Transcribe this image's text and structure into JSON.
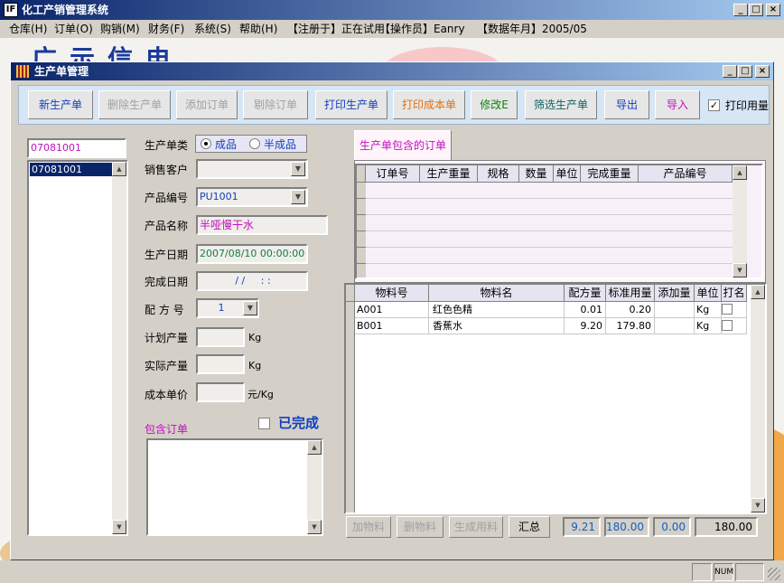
{
  "app": {
    "title": "化工产销管理系统",
    "icon_text": "IF"
  },
  "menu": [
    {
      "label": "仓库(H)"
    },
    {
      "label": "订单(O)"
    },
    {
      "label": "购销(M)"
    },
    {
      "label": "财务(F)"
    },
    {
      "label": "系统(S)"
    },
    {
      "label": "帮助(H)"
    }
  ],
  "menu_info": {
    "registered": "【注册于】正在试用",
    "operator": "【操作员】Eanry",
    "data_month": "【数据年月】2005/05"
  },
  "banner": {
    "text": "广示信电"
  },
  "window": {
    "title": "生产单管理"
  },
  "toolbar": {
    "new": "新生产单",
    "delete": "删除生产单",
    "add_order": "添加订单",
    "remove_order": "剔除订单",
    "print_prod": "打印生产单",
    "print_cost": "打印成本单",
    "modify": "修改E",
    "filter": "筛选生产单",
    "export": "导出",
    "import": "导入",
    "print_usage": "打印用量"
  },
  "left_list": {
    "current": "07081001",
    "items": [
      "07081001"
    ]
  },
  "form": {
    "type_label": "生产单类",
    "type_options": [
      "成品",
      "半成品"
    ],
    "type_selected": "成品",
    "customer_label": "销售客户",
    "customer_value": "",
    "product_code_label": "产品编号",
    "product_code_value": "PU1001",
    "product_name_label": "产品名称",
    "product_name_value": "半哑慢干水",
    "prod_date_label": "生产日期",
    "prod_date_value": "2007/08/10 00:00:00",
    "done_date_label": "完成日期",
    "done_date_value": "/ /     : :",
    "formula_label": "配 方 号",
    "formula_value": "1",
    "plan_label": "计划产量",
    "plan_value": "",
    "plan_unit": "Kg",
    "actual_label": "实际产量",
    "actual_value": "",
    "actual_unit": "Kg",
    "cost_label": "成本单价",
    "cost_value": "",
    "cost_unit": "元/Kg",
    "orders_label": "包含订单",
    "completed_label": "已完成"
  },
  "orders_grid": {
    "tab": "生产单包含的订单",
    "columns": [
      "订单号",
      "生产重量",
      "规格",
      "数量",
      "单位",
      "完成重量",
      "产品编号"
    ]
  },
  "materials_grid": {
    "columns": [
      "物料号",
      "物料名",
      "配方量",
      "标准用量",
      "添加量",
      "单位",
      "打名"
    ],
    "rows": [
      {
        "code": "A001",
        "name": "红色色精",
        "ratio": "0.01",
        "std": "0.20",
        "add": "",
        "unit": "Kg"
      },
      {
        "code": "B001",
        "name": "香蕉水",
        "ratio": "9.20",
        "std": "179.80",
        "add": "",
        "unit": "Kg"
      }
    ]
  },
  "bottom": {
    "add_material": "加物料",
    "del_material": "删物料",
    "gen_usage": "生成用料",
    "summary": "汇总",
    "sum_ratio": "9.21",
    "sum_std": "180.00",
    "sum_add": "0.00",
    "sum_total": "180.00"
  },
  "status": {
    "num": "NUM"
  }
}
